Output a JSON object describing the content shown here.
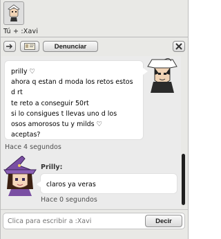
{
  "window": {
    "title": "Tú + :Xavi"
  },
  "toolbar": {
    "report_label": "Denunciar"
  },
  "messages": [
    {
      "from": "right",
      "lines": [
        "prilly ♡",
        "ahora q estan d moda los retos estos",
        "d rt",
        "te reto a conseguir 50rt",
        "si lo consigues t llevas uno d los",
        "osos amorosos tu y milds ♡",
        "aceptas?"
      ],
      "timestamp": "Hace 4 segundos"
    },
    {
      "from": "left",
      "sender": "Prilly:",
      "text": "claros ya veras",
      "timestamp": "Hace 0 segundos"
    }
  ],
  "input": {
    "placeholder": "Clica para escribir a :Xavi",
    "send_label": "Decir"
  },
  "colors": {
    "window_bg": "#e9e9e6",
    "chat_bg": "#ebebeb",
    "bubble_bg": "#ffffff",
    "scroll_thumb": "#1f1f1f"
  },
  "icons": [
    "habbo-avatar-icon",
    "arrow-right-icon",
    "profile-card-icon",
    "close-icon",
    "avatar-xavi",
    "avatar-prilly"
  ]
}
